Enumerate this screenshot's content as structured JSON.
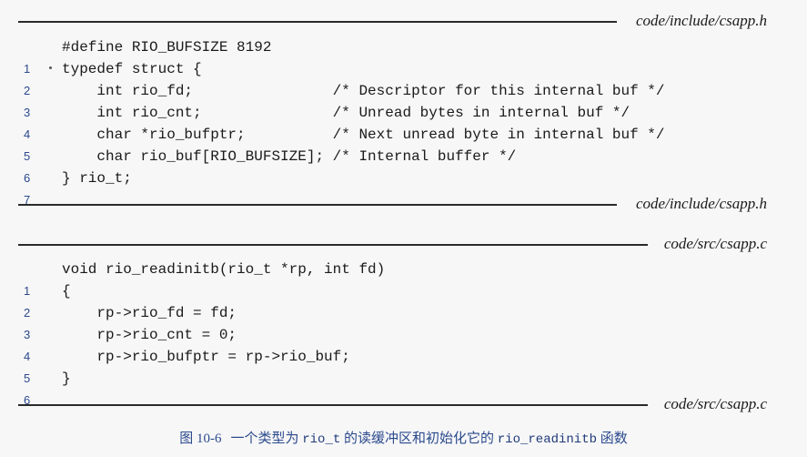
{
  "header_block": {
    "file_top": "code/include/csapp.h",
    "file_bottom": "code/include/csapp.h",
    "lines": [
      {
        "no": "1",
        "code": "#define RIO_BUFSIZE 8192"
      },
      {
        "no": "2",
        "code": "typedef struct {"
      },
      {
        "no": "3",
        "code": "    int rio_fd;                /* Descriptor for this internal buf */"
      },
      {
        "no": "4",
        "code": "    int rio_cnt;               /* Unread bytes in internal buf */"
      },
      {
        "no": "5",
        "code": "    char *rio_bufptr;          /* Next unread byte in internal buf */"
      },
      {
        "no": "6",
        "code": "    char rio_buf[RIO_BUFSIZE]; /* Internal buffer */"
      },
      {
        "no": "7",
        "code": "} rio_t;"
      }
    ]
  },
  "source_block": {
    "file_top": "code/src/csapp.c",
    "file_bottom": "code/src/csapp.c",
    "lines": [
      {
        "no": "1",
        "code": "void rio_readinitb(rio_t *rp, int fd)"
      },
      {
        "no": "2",
        "code": "{"
      },
      {
        "no": "3",
        "code": "    rp->rio_fd = fd;"
      },
      {
        "no": "4",
        "code": "    rp->rio_cnt = 0;"
      },
      {
        "no": "5",
        "code": "    rp->rio_bufptr = rp->rio_buf;"
      },
      {
        "no": "6",
        "code": "}"
      }
    ]
  },
  "caption": {
    "figure_number": "图 10-6",
    "text_before": "一个类型为 ",
    "type_name": "rio_t",
    "text_middle": " 的读缓冲区和初始化它的 ",
    "func_name": "rio_readinitb",
    "text_after": " 函数"
  }
}
